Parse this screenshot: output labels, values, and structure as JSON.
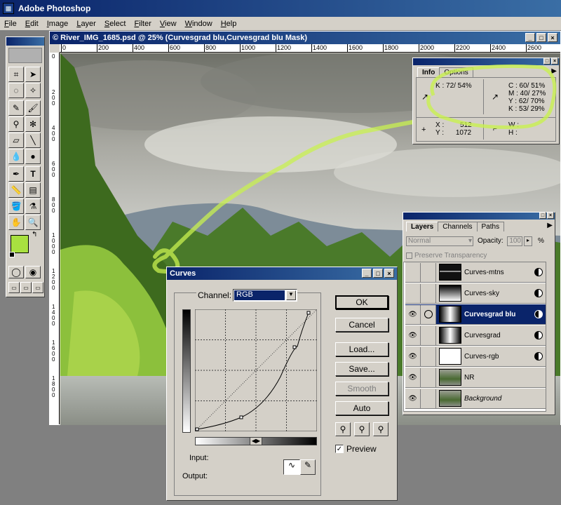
{
  "app": {
    "title": "Adobe Photoshop"
  },
  "menu": [
    {
      "label": "File",
      "u": "F",
      "rest": "ile"
    },
    {
      "label": "Edit",
      "u": "E",
      "rest": "dit"
    },
    {
      "label": "Image",
      "u": "I",
      "rest": "mage"
    },
    {
      "label": "Layer",
      "u": "L",
      "rest": "ayer"
    },
    {
      "label": "Select",
      "u": "S",
      "rest": "elect"
    },
    {
      "label": "Filter",
      "u": "F",
      "rest": "ilter"
    },
    {
      "label": "View",
      "u": "V",
      "rest": "iew"
    },
    {
      "label": "Window",
      "u": "W",
      "rest": "indow"
    },
    {
      "label": "Help",
      "u": "H",
      "rest": "elp"
    }
  ],
  "document": {
    "title": "© River_IMG_1685.psd @ 25% (Curvesgrad blu,Curvesgrad blu Mask)",
    "ruler_h": [
      "0",
      "200",
      "400",
      "600",
      "800",
      "1000",
      "1200",
      "1400",
      "1600",
      "1800",
      "2000",
      "2200",
      "2400",
      "2600"
    ],
    "ruler_v": [
      "0",
      "200",
      "400",
      "600",
      "800",
      "1000",
      "1200",
      "1400",
      "1600",
      "1800"
    ]
  },
  "info": {
    "tabs": [
      "Info",
      "Options"
    ],
    "k_top": "K :  72/ 54%",
    "c": "C :  60/ 51%",
    "m": "M :  40/ 27%",
    "y": "Y :  62/ 70%",
    "k": "K :  53/ 29%",
    "x_label": "X :",
    "x_val": "512",
    "y_label": "Y :",
    "y_val": "1072",
    "w_label": "W :",
    "h_label": "H :"
  },
  "layers": {
    "tabs": [
      "Layers",
      "Channels",
      "Paths"
    ],
    "blend_mode": "Normal",
    "opacity_label": "Opacity:",
    "opacity_value": "100",
    "opacity_unit": "%",
    "preserve": "Preserve Transparency",
    "items": [
      {
        "name": "Curves-mtns",
        "visible": false,
        "italic": false
      },
      {
        "name": "Curves-sky",
        "visible": false,
        "italic": false
      },
      {
        "name": "Curvesgrad blu",
        "visible": true,
        "italic": false
      },
      {
        "name": "Curvesgrad",
        "visible": true,
        "italic": false
      },
      {
        "name": "Curves-rgb",
        "visible": true,
        "italic": false
      },
      {
        "name": "NR",
        "visible": true,
        "italic": false
      },
      {
        "name": "Background",
        "visible": true,
        "italic": true
      }
    ]
  },
  "curves": {
    "title": "Curves",
    "channel_label": "Channel:",
    "channel_value": "RGB",
    "ok": "OK",
    "cancel": "Cancel",
    "load": "Load...",
    "save": "Save...",
    "smooth": "Smooth",
    "auto": "Auto",
    "preview": "Preview",
    "input_label": "Input:",
    "output_label": "Output:"
  },
  "colors": {
    "foreground": "#a8e040",
    "background": "#ffffff",
    "highlight_stroke": "#c8f050"
  }
}
